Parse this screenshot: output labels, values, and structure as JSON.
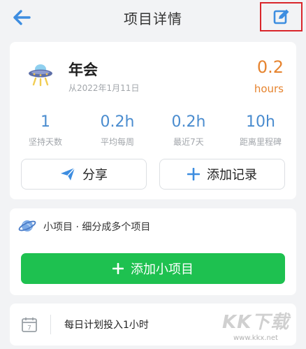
{
  "header": {
    "title": "项目详情",
    "back_icon": "arrow-left-icon",
    "edit_icon": "edit-icon"
  },
  "project": {
    "icon": "ufo-icon",
    "name": "年会",
    "since": "从2022年1月11日",
    "hours_value": "0.2",
    "hours_unit": "hours"
  },
  "stats": [
    {
      "value": "1",
      "label": "坚持天数"
    },
    {
      "value": "0.2h",
      "label": "平均每周"
    },
    {
      "value": "0.2h",
      "label": "最近7天"
    },
    {
      "value": "10h",
      "label": "距离里程碑"
    }
  ],
  "actions": {
    "share_label": "分享",
    "add_record_label": "添加记录"
  },
  "subprojects": {
    "title": "小项目 · 细分成多个项目",
    "add_label": "添加小项目"
  },
  "plan": {
    "text": "每日计划投入1小时",
    "icon_day": "7"
  },
  "watermark": {
    "main": "KK下载",
    "url": "www.kkx.net"
  },
  "colors": {
    "accent_blue": "#3d8de0",
    "hours_orange": "#e6842f",
    "green": "#1ec150",
    "highlight_red": "#d9262b"
  }
}
